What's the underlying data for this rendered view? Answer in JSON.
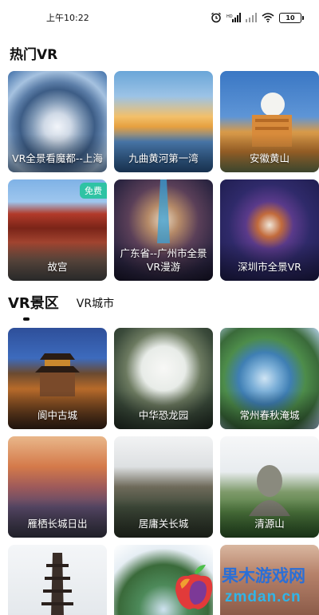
{
  "status_bar": {
    "time": "上午10:22",
    "battery": "10"
  },
  "hot_section": {
    "title": "热门VR",
    "items": [
      {
        "label": "VR全景看魔都--上海"
      },
      {
        "label": "九曲黄河第一湾"
      },
      {
        "label": "安徽黄山"
      },
      {
        "label": "故宫",
        "badge": "免费"
      },
      {
        "label": "广东省--广州市全景VR漫游"
      },
      {
        "label": "深圳市全景VR"
      }
    ]
  },
  "tabs": [
    {
      "label": "VR景区",
      "active": true
    },
    {
      "label": "VR城市",
      "active": false
    }
  ],
  "spots": {
    "items": [
      {
        "label": "阆中古城"
      },
      {
        "label": "中华恐龙园"
      },
      {
        "label": "常州春秋淹城"
      },
      {
        "label": "雁栖长城日出"
      },
      {
        "label": "居庸关长城"
      },
      {
        "label": "清源山"
      }
    ]
  },
  "watermark": {
    "main": "果木游戏网",
    "sub": "zmdan.cn"
  }
}
